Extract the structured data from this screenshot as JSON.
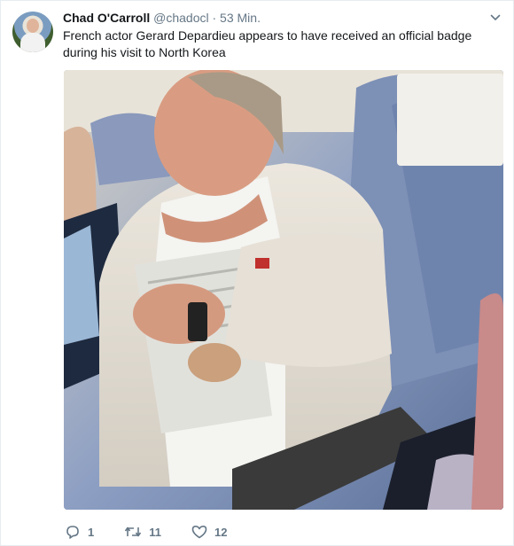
{
  "tweet": {
    "author_name": "Chad O'Carroll",
    "handle": "@chadocl",
    "separator": "·",
    "time": "53 Min.",
    "text": "French actor Gerard Depardieu appears to have received an official badge during his visit to North Korea"
  },
  "actions": {
    "reply_count": "1",
    "retweet_count": "11",
    "like_count": "12"
  },
  "icons": {
    "menu": "chevron-down-icon",
    "reply": "reply-icon",
    "retweet": "retweet-icon",
    "like": "heart-icon"
  },
  "colors": {
    "secondary_text": "#657786",
    "border": "#e6ecf0"
  }
}
